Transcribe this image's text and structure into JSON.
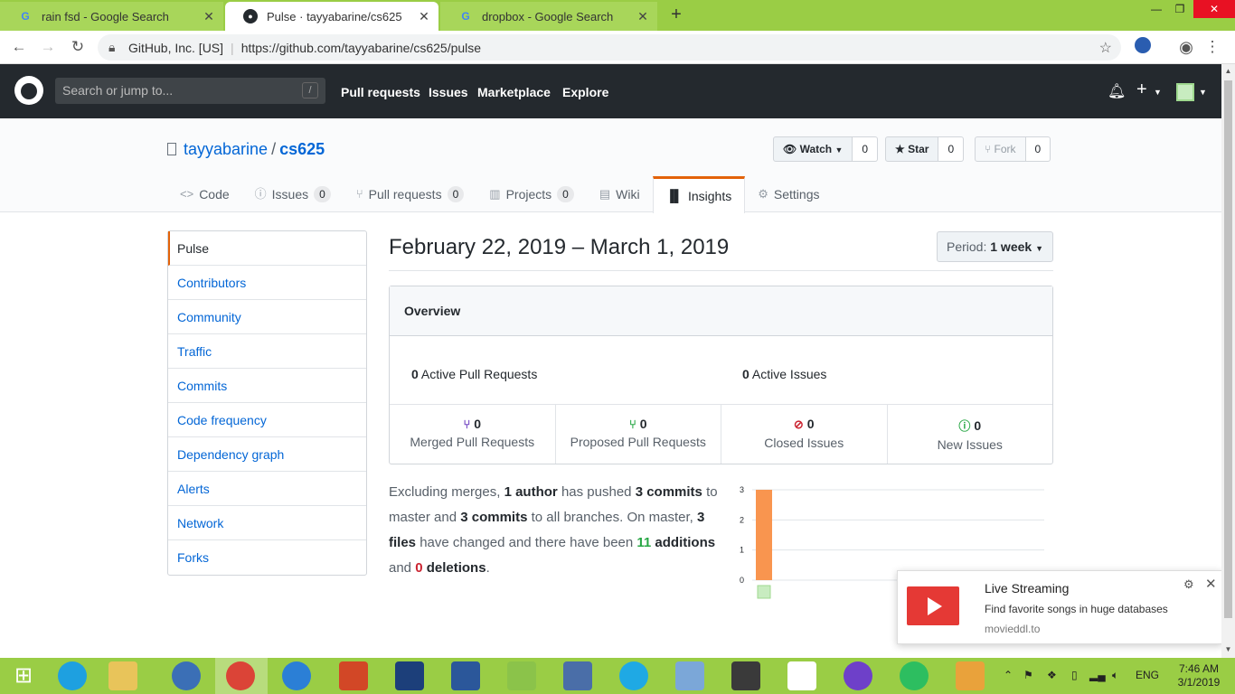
{
  "browser": {
    "tabs": [
      {
        "title": "rain fsd - Google Search",
        "favicon": "google-icon",
        "active": false
      },
      {
        "title": "Pulse · tayyabarine/cs625",
        "favicon": "github-icon",
        "active": true
      },
      {
        "title": "dropbox - Google Search",
        "favicon": "google-icon",
        "active": false
      }
    ],
    "new_tab": "+",
    "address": {
      "site": "GitHub, Inc. [US]",
      "url": "https://github.com/tayyabarine/cs625/pulse"
    }
  },
  "github": {
    "search_placeholder": "Search or jump to...",
    "search_key": "/",
    "nav": [
      "Pull requests",
      "Issues",
      "Marketplace",
      "Explore"
    ],
    "repo": {
      "owner": "tayyabarine",
      "separator": "/",
      "name": "cs625"
    },
    "actions": {
      "watch": {
        "label": "Watch",
        "count": "0"
      },
      "star": {
        "label": "Star",
        "count": "0"
      },
      "fork": {
        "label": "Fork",
        "count": "0"
      }
    },
    "tabs": [
      {
        "label": "Code",
        "icon": "code-icon",
        "count": null
      },
      {
        "label": "Issues",
        "icon": "issue-icon",
        "count": "0"
      },
      {
        "label": "Pull requests",
        "icon": "pr-icon",
        "count": "0"
      },
      {
        "label": "Projects",
        "icon": "project-icon",
        "count": "0"
      },
      {
        "label": "Wiki",
        "icon": "book-icon",
        "count": null
      },
      {
        "label": "Insights",
        "icon": "graph-icon",
        "count": null,
        "selected": true
      },
      {
        "label": "Settings",
        "icon": "gear-icon",
        "count": null
      }
    ],
    "menu": [
      "Pulse",
      "Contributors",
      "Community",
      "Traffic",
      "Commits",
      "Code frequency",
      "Dependency graph",
      "Alerts",
      "Network",
      "Forks"
    ],
    "pulse": {
      "date_range": "February 22, 2019 – March 1, 2019",
      "period_label": "Period:",
      "period_value": "1 week",
      "overview_title": "Overview",
      "active_pr_count": "0",
      "active_pr_label": "Active Pull Requests",
      "active_issues_count": "0",
      "active_issues_label": "Active Issues",
      "stats": [
        {
          "count": "0",
          "label": "Merged Pull Requests",
          "color": "#6f42c1"
        },
        {
          "count": "0",
          "label": "Proposed Pull Requests",
          "color": "#28a745"
        },
        {
          "count": "0",
          "label": "Closed Issues",
          "color": "#cb2431"
        },
        {
          "count": "0",
          "label": "New Issues",
          "color": "#28a745"
        }
      ],
      "summary": {
        "s1": "Excluding merges,",
        "authors": "1 author",
        "s2": "has pushed",
        "commits_master": "3 commits",
        "s3": "to master and",
        "commits_all": "3 commits",
        "s4": "to all branches. On master,",
        "files": "3 files",
        "s5": "have changed and there have been",
        "additions_num": "11",
        "additions_word": "additions",
        "s6": "and",
        "deletions_num": "0",
        "deletions_word": "deletions",
        "s7": "."
      }
    }
  },
  "chart_data": {
    "type": "bar",
    "categories": [
      "author"
    ],
    "values": [
      3
    ],
    "ylim": [
      0,
      3
    ],
    "yticks": [
      "0",
      "1",
      "2",
      "3"
    ],
    "color": "#f9954f",
    "grid": true
  },
  "notification": {
    "title": "Live Streaming",
    "body": "Find favorite songs in huge databases",
    "source": "movieddl.to"
  },
  "taskbar": {
    "language": "ENG",
    "time": "7:46 AM",
    "date": "3/1/2019"
  }
}
